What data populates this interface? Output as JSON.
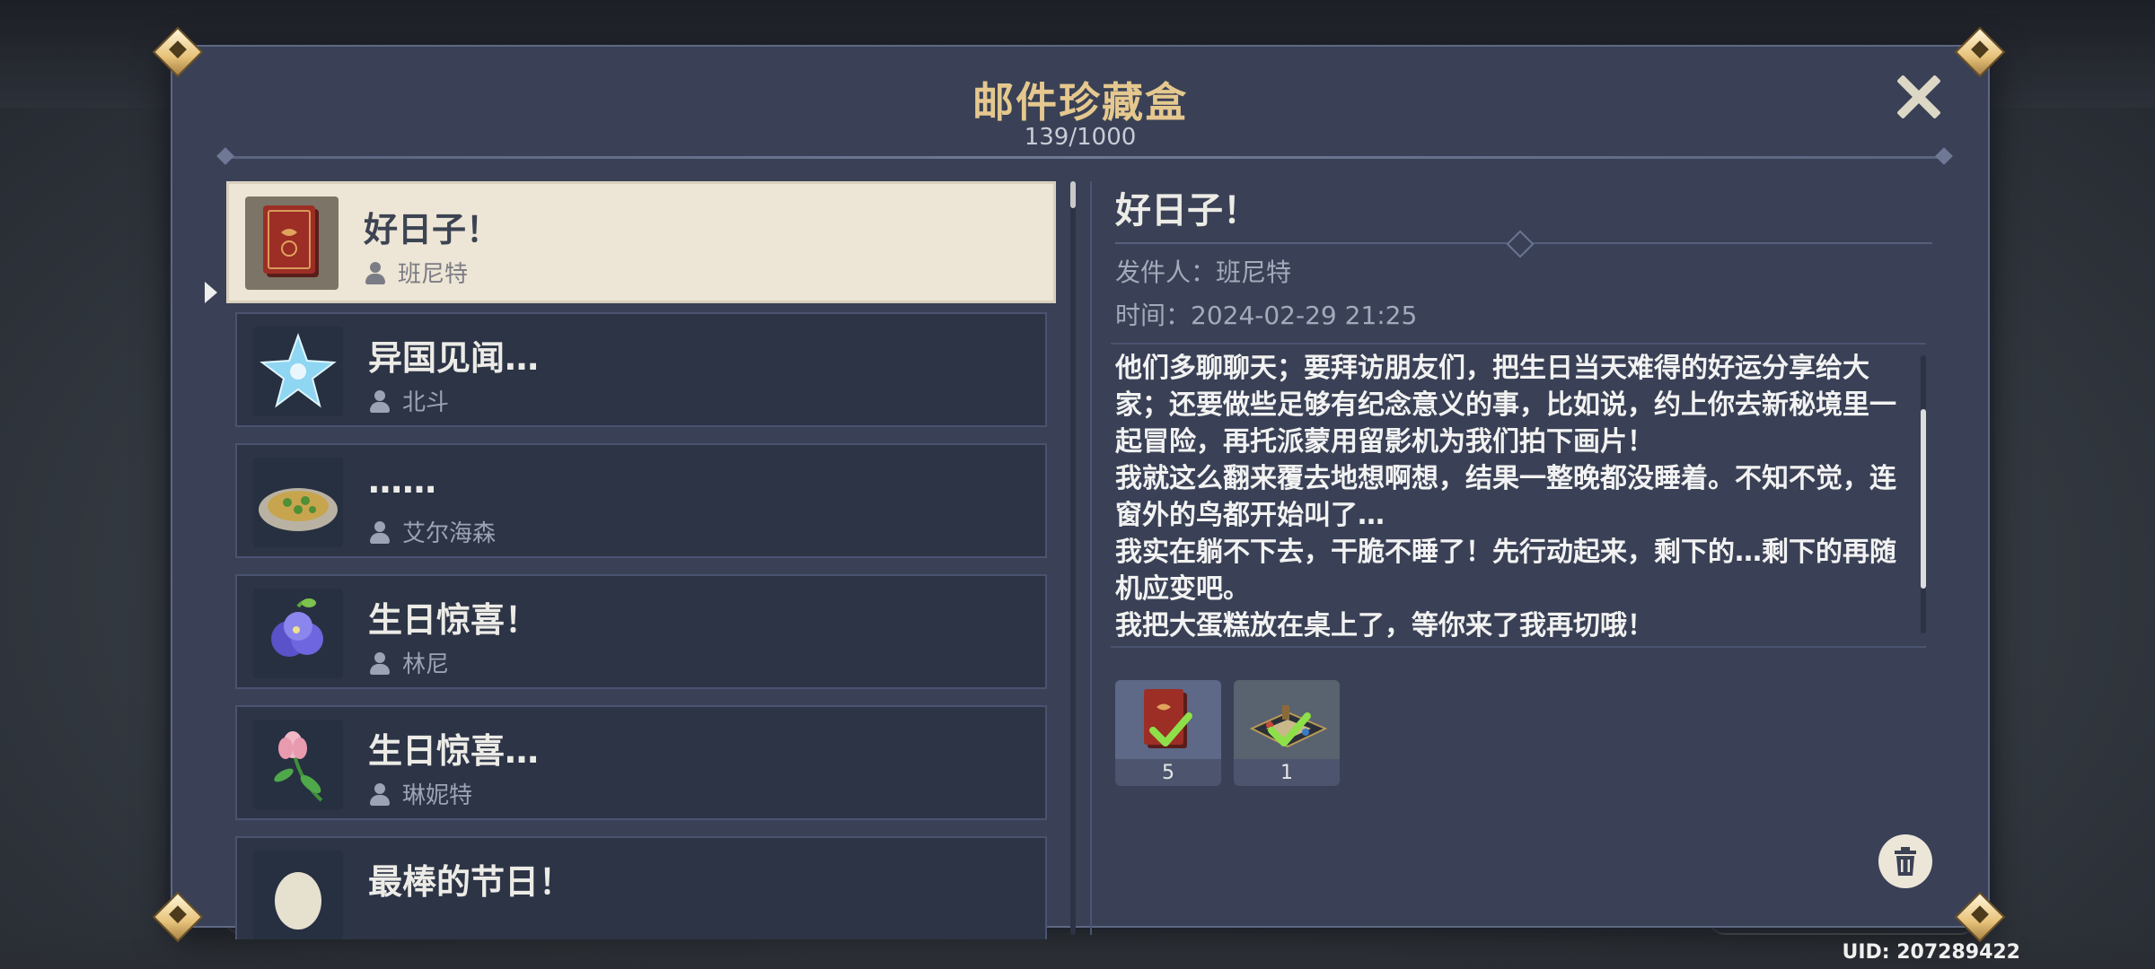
{
  "dialog": {
    "title": "邮件珍藏盒",
    "count": "139/1000"
  },
  "mail_list": [
    {
      "title": "好日子！",
      "sender": "班尼特",
      "icon": "red-book-icon",
      "selected": true
    },
    {
      "title": "异国见闻…",
      "sender": "北斗",
      "icon": "blue-star-icon",
      "selected": false
    },
    {
      "title": "……",
      "sender": "艾尔海森",
      "icon": "food-plate-icon",
      "selected": false
    },
    {
      "title": "生日惊喜！",
      "sender": "林尼",
      "icon": "blue-flower-icon",
      "selected": false
    },
    {
      "title": "生日惊喜…",
      "sender": "琳妮特",
      "icon": "pink-flower-icon",
      "selected": false
    },
    {
      "title": "最棒的节日！",
      "sender": "",
      "icon": "egg-icon",
      "selected": false
    }
  ],
  "message": {
    "title": "好日子！",
    "sender_line": "发件人：班尼特",
    "time_line": "时间：2024-02-29 21:25",
    "body_lines": [
      "他们多聊聊天；要拜访朋友们，把生日当天难得的好运分享给大家；还要做些足够有纪念意义的事，比如说，约上你去新秘境里一起冒险，再托派蒙用留影机为我们拍下画片！",
      "我就这么翻来覆去地想啊想，结果一整晚都没睡着。不知不觉，连窗外的鸟都开始叫了…",
      "我实在躺不下去，干脆不睡了！先行动起来，剩下的…剩下的再随机应变吧。",
      "我把大蛋糕放在桌上了，等你来了我再切哦！"
    ]
  },
  "attachments": [
    {
      "icon": "red-book-icon",
      "qty": "5",
      "claimed": true
    },
    {
      "icon": "board-game-icon",
      "qty": "1",
      "claimed": true
    }
  ],
  "footer": {
    "uid": "UID: 207289422"
  },
  "colors": {
    "panel_bg": "#3a4156",
    "title_gold": "#e5c88e",
    "selected_item_bg": "#ede5d5",
    "check_green": "#8ee04a"
  }
}
